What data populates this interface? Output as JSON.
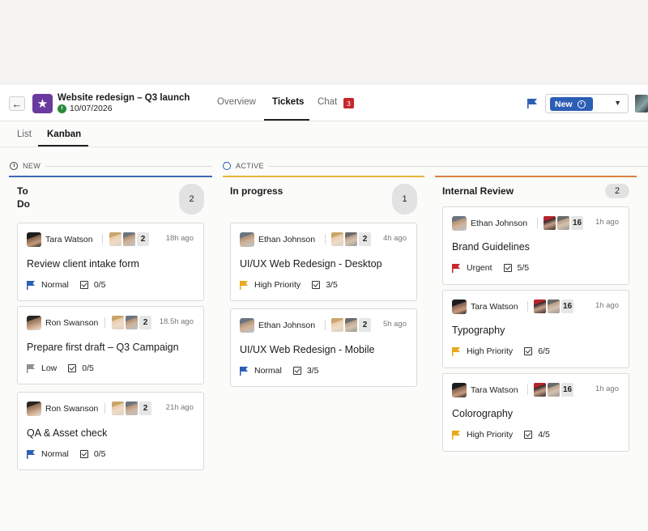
{
  "header": {
    "back_icon": "arrow-left-icon",
    "project_icon": "star-icon",
    "project_title": "Website redesign – Q3 launch",
    "project_date": "10/07/2026",
    "tabs": [
      {
        "label": "Overview"
      },
      {
        "label": "Tickets",
        "active": true
      },
      {
        "label": "Chat",
        "badge": "3"
      }
    ],
    "status_label": "New"
  },
  "view_tabs": [
    {
      "label": "List"
    },
    {
      "label": "Kanban",
      "active": true
    }
  ],
  "groups": [
    {
      "label": "NEW",
      "icon": "clock-icon"
    },
    {
      "label": "ACTIVE",
      "icon": "dots-circle-icon"
    }
  ],
  "columns": [
    {
      "title_line1": "To",
      "title_line2": "Do",
      "count": "2",
      "accent": "#3d69b3",
      "cards": [
        {
          "owner": "Tara Watson",
          "assignee_count": "2",
          "time": "18h ago",
          "title": "Review client intake form",
          "priority": "Normal",
          "priority_color": "#2d5eb5",
          "checklist": "0/5"
        },
        {
          "owner": "Ron Swanson",
          "assignee_count": "2",
          "time": "18.5h ago",
          "title": "Prepare first draft – Q3 Campaign",
          "priority": "Low",
          "priority_color": "#8f8f8f",
          "checklist": "0/5"
        },
        {
          "owner": "Ron Swanson",
          "assignee_count": "2",
          "time": "21h ago",
          "title": "QA & Asset check",
          "priority": "Normal",
          "priority_color": "#2d5eb5",
          "checklist": "0/5"
        }
      ]
    },
    {
      "title": "In progress",
      "count": "1",
      "accent": "#e6b53a",
      "cards": [
        {
          "owner": "Ethan Johnson",
          "assignee_count": "2",
          "time": "4h ago",
          "title": "UI/UX Web Redesign - Desktop",
          "priority": "High Priority",
          "priority_color": "#e8a91c",
          "checklist": "3/5"
        },
        {
          "owner": "Ethan Johnson",
          "assignee_count": "2",
          "time": "5h ago",
          "title": "UI/UX Web Redesign - Mobile",
          "priority": "Normal",
          "priority_color": "#2d5eb5",
          "checklist": "3/5"
        }
      ]
    },
    {
      "title": "Internal Review",
      "count": "2",
      "accent": "#d9813f",
      "cards": [
        {
          "owner": "Ethan Johnson",
          "assignee_count": "16",
          "time": "1h ago",
          "title": "Brand Guidelines",
          "priority": "Urgent",
          "priority_color": "#c8262b",
          "checklist": "5/5"
        },
        {
          "owner": "Tara Watson",
          "assignee_count": "16",
          "time": "1h ago",
          "title": "Typography",
          "priority": "High Priority",
          "priority_color": "#e8a91c",
          "checklist": "6/5"
        },
        {
          "owner": "Tara Watson",
          "assignee_count": "16",
          "time": "1h ago",
          "title": "Colorography",
          "priority": "High Priority",
          "priority_color": "#e8a91c",
          "checklist": "4/5"
        }
      ]
    }
  ]
}
